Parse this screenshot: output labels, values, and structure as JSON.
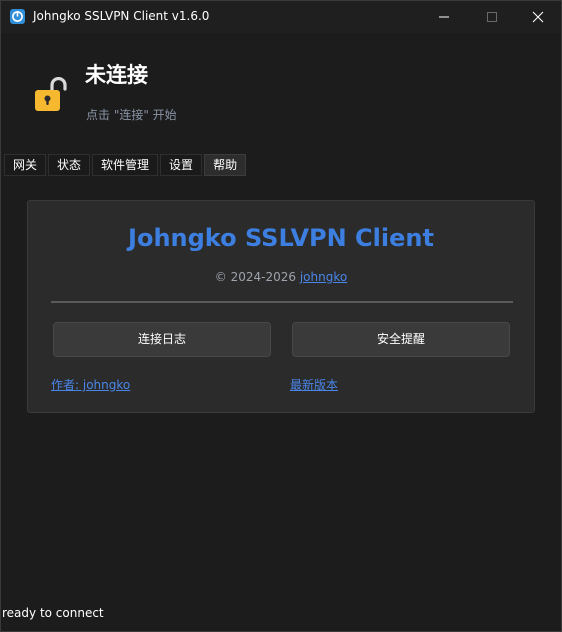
{
  "window": {
    "title": "Johngko SSLVPN Client v1.6.0",
    "icons": {
      "app": "app-logo-icon",
      "minimize": "minimize-icon",
      "maximize": "maximize-icon",
      "close": "close-icon"
    }
  },
  "status": {
    "title": "未连接",
    "hint": "点击 \"连接\" 开始",
    "icon": "unlocked-padlock-icon",
    "icon_color": "#f5b82e"
  },
  "tabs": [
    {
      "label": "网关",
      "active": false
    },
    {
      "label": "状态",
      "active": false
    },
    {
      "label": "软件管理",
      "active": false
    },
    {
      "label": "设置",
      "active": false
    },
    {
      "label": "帮助",
      "active": true
    }
  ],
  "help": {
    "app_name": "Johngko SSLVPN Client",
    "copyright_prefix": "© 2024-2026",
    "copyright_link": "johngko",
    "buttons": {
      "log": "连接日志",
      "security": "安全提醒"
    },
    "links": {
      "author": "作者: johngko",
      "latest": "最新版本"
    }
  },
  "statusbar": {
    "text": "ready to connect"
  },
  "colors": {
    "accent": "#3d7fe0",
    "link": "#4a86e8",
    "background": "#1c1c1c",
    "panel": "#2b2b2b"
  }
}
